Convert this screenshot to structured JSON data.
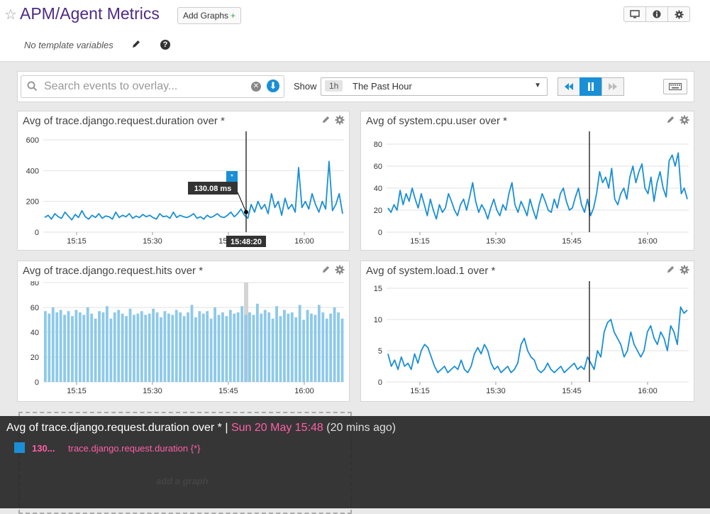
{
  "header": {
    "title": "APM/Agent Metrics",
    "add_graphs_label": "Add Graphs",
    "add_graphs_plus": "+",
    "no_template": "No template variables",
    "help_glyph": "?",
    "icons": [
      "tv-icon",
      "info-icon",
      "gear-icon"
    ]
  },
  "toolbar": {
    "search_placeholder": "Search events to overlay...",
    "show_label": "Show",
    "time_badge": "1h",
    "time_value": "The Past Hour"
  },
  "panels": [
    {
      "title": "Avg of trace.django.request.duration over *",
      "y_ticks": [
        "600",
        "400",
        "200",
        "0"
      ],
      "x_ticks": [
        "15:15",
        "15:30",
        "15:45",
        "16:00"
      ],
      "tooltip_value": "130.08 ms",
      "tooltip_time": "15:48:20",
      "event_marker": "*",
      "color": "#1a8fd6"
    },
    {
      "title": "Avg of system.cpu.user over *",
      "y_ticks": [
        "80",
        "60",
        "40",
        "20",
        "0"
      ],
      "x_ticks": [
        "15:15",
        "15:30",
        "15:45",
        "16:00"
      ],
      "color": "#1a8fd6"
    },
    {
      "title": "Avg of trace.django.request.hits over *",
      "y_ticks": [
        "80",
        "60",
        "40",
        "20",
        "0"
      ],
      "x_ticks": [
        "15:15",
        "15:30",
        "15:45",
        "16:00"
      ],
      "color": "#8ec9ea"
    },
    {
      "title": "Avg of system.load.1 over *",
      "y_ticks": [
        "15",
        "10",
        "5",
        "0"
      ],
      "x_ticks": [
        "15:15",
        "15:30",
        "15:45",
        "16:00"
      ],
      "color": "#1a8fd6"
    }
  ],
  "overlay": {
    "title_main": "Avg of trace.django.request.duration over * | ",
    "title_date": "Sun 20 May 15:48",
    "title_ago": " (20 mins ago)",
    "legend_value": "130...",
    "legend_metric": "trace.django.request.duration {*}",
    "add_graph_label": "add a graph"
  },
  "chart_data": [
    {
      "type": "line",
      "title": "Avg of trace.django.request.duration over *",
      "x_ticks": [
        "15:15",
        "15:30",
        "15:45",
        "16:00"
      ],
      "ylim": [
        0,
        600
      ],
      "hover": {
        "time": "15:48:20",
        "value": 130.08
      },
      "series": [
        {
          "values": [
            95,
            110,
            85,
            120,
            100,
            90,
            130,
            105,
            80,
            115,
            95,
            140,
            100,
            85,
            110,
            95,
            120,
            90,
            105,
            100,
            85,
            130,
            95,
            110,
            100,
            120,
            90,
            105,
            95,
            115,
            100,
            110,
            95,
            85,
            120,
            100,
            105,
            90,
            130,
            95,
            110,
            100,
            95,
            105,
            120,
            90,
            100,
            85,
            110,
            95,
            105,
            120,
            100,
            95,
            110,
            130,
            100,
            120,
            150,
            110,
            90,
            180,
            130,
            200,
            150,
            180,
            120,
            250,
            160,
            200,
            110,
            220,
            150,
            180,
            130,
            420,
            160,
            200,
            150,
            250,
            180,
            130,
            200,
            150,
            460,
            140,
            180,
            250,
            120
          ]
        }
      ]
    },
    {
      "type": "line",
      "title": "Avg of system.cpu.user over *",
      "x_ticks": [
        "15:15",
        "15:30",
        "15:45",
        "16:00"
      ],
      "ylim": [
        0,
        80
      ],
      "series": [
        {
          "values": [
            22,
            18,
            25,
            20,
            38,
            25,
            35,
            28,
            40,
            30,
            22,
            35,
            25,
            15,
            30,
            20,
            12,
            25,
            18,
            22,
            35,
            28,
            20,
            15,
            25,
            30,
            20,
            32,
            45,
            28,
            18,
            25,
            20,
            12,
            22,
            30,
            20,
            15,
            25,
            20,
            35,
            45,
            25,
            18,
            28,
            22,
            15,
            30,
            20,
            12,
            25,
            35,
            28,
            20,
            18,
            30,
            22,
            35,
            40,
            28,
            20,
            22,
            32,
            40,
            25,
            18,
            30,
            15,
            22,
            35,
            55,
            45,
            50,
            40,
            58,
            30,
            25,
            35,
            40,
            30,
            50,
            60,
            45,
            55,
            62,
            40,
            35,
            50,
            28,
            45,
            55,
            40,
            32,
            65,
            70,
            60,
            72,
            35,
            40,
            30
          ]
        }
      ]
    },
    {
      "type": "bar",
      "title": "Avg of trace.django.request.hits over *",
      "x_ticks": [
        "15:15",
        "15:30",
        "15:45",
        "16:00"
      ],
      "ylim": [
        0,
        80
      ],
      "series": [
        {
          "values": [
            57,
            55,
            60,
            56,
            58,
            54,
            57,
            53,
            58,
            56,
            54,
            60,
            55,
            51,
            57,
            56,
            61,
            51,
            56,
            58,
            55,
            53,
            59,
            54,
            55,
            57,
            54,
            55,
            59,
            56,
            52,
            57,
            55,
            54,
            58,
            56,
            53,
            56,
            62,
            52,
            57,
            55,
            57,
            51,
            60,
            54,
            56,
            53,
            58,
            55,
            56,
            61,
            54,
            56,
            54,
            63,
            55,
            58,
            56,
            51,
            61,
            53,
            58,
            55,
            56,
            52,
            62,
            50,
            58,
            55,
            54,
            62,
            56,
            51,
            55,
            60,
            56,
            51
          ]
        }
      ]
    },
    {
      "type": "line",
      "title": "Avg of system.load.1 over *",
      "x_ticks": [
        "15:15",
        "15:30",
        "15:45",
        "16:00"
      ],
      "ylim": [
        0,
        15
      ],
      "series": [
        {
          "values": [
            4.5,
            2.5,
            3.5,
            2,
            4,
            2.5,
            3,
            2,
            4.5,
            3,
            5,
            6,
            5.5,
            4,
            2.5,
            1.5,
            2,
            2.5,
            1.5,
            2,
            2.5,
            2,
            3.5,
            2,
            1.5,
            2.5,
            4.5,
            5.5,
            4.5,
            6,
            5,
            3,
            2,
            2.5,
            1.5,
            2,
            2.5,
            1.5,
            2,
            3,
            6,
            7,
            5,
            4,
            3.5,
            2,
            1.5,
            2,
            3,
            2,
            1.5,
            2,
            2.5,
            1.5,
            2,
            2.5,
            3,
            2,
            2.5,
            2,
            4,
            3,
            2,
            5,
            4,
            8,
            9.5,
            10,
            8,
            7,
            6,
            4,
            5,
            8,
            6,
            5,
            4,
            5,
            8,
            9,
            7,
            6,
            8,
            7,
            5,
            9,
            8,
            6,
            12,
            11,
            11.5
          ]
        }
      ]
    }
  ]
}
